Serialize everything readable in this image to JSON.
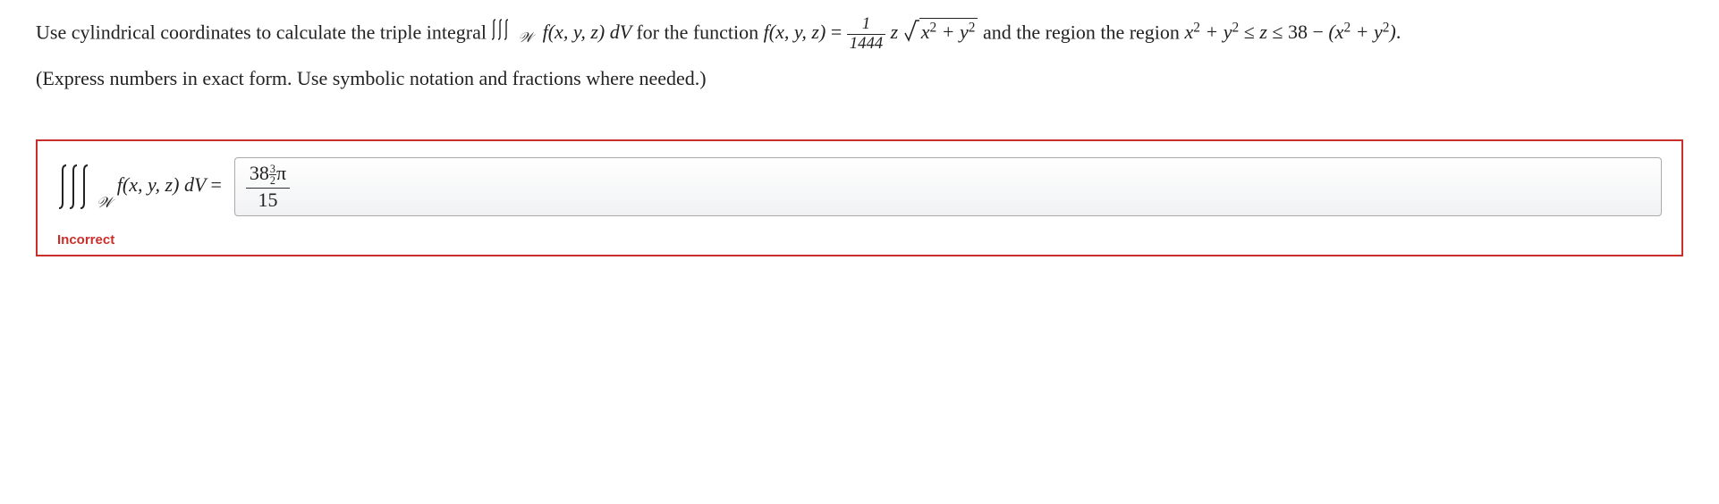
{
  "problem": {
    "prefix": "Use cylindrical coordinates to calculate the triple integral ",
    "integral_expr": "∭_𝒲 f(x, y, z) dV",
    "after_integral": " for the function ",
    "func_lhs": "f(x, y, z) = ",
    "frac_num": "1",
    "frac_den": "1444",
    "z_str": "z",
    "sqrt_inner": "x² + y²",
    "after_func": " and the region ",
    "region": "x² + y² ≤ z ≤ 38 − (x² + y²).",
    "hint": "(Express numbers in exact form. Use symbolic notation and fractions where needed.)"
  },
  "answer": {
    "lhs_integrand": " f(x, y, z) dV = ",
    "sub_w": "𝒲",
    "entered_num_base": "38",
    "entered_num_exp_n": "3",
    "entered_num_exp_d": "2",
    "entered_num_tail": "π",
    "entered_den": "15",
    "status": "Incorrect"
  }
}
